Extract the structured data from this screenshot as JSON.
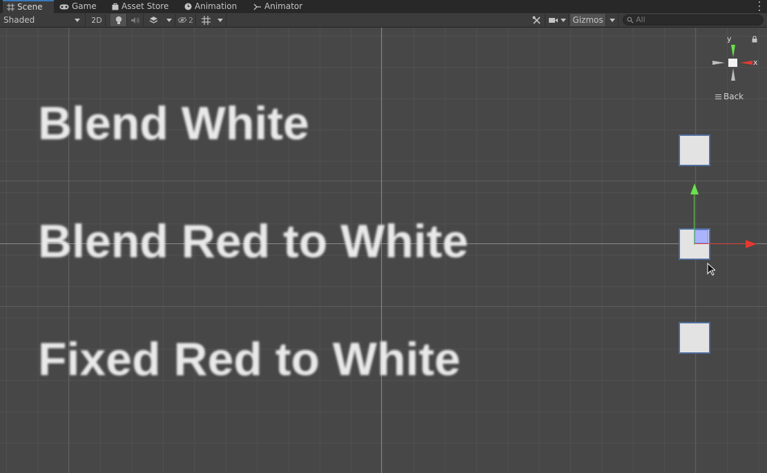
{
  "tabs": [
    {
      "label": "Scene",
      "icon": "grid-icon",
      "active": true
    },
    {
      "label": "Game",
      "icon": "gamepad-icon",
      "active": false
    },
    {
      "label": "Asset Store",
      "icon": "bag-icon",
      "active": false
    },
    {
      "label": "Animation",
      "icon": "clock-icon",
      "active": false
    },
    {
      "label": "Animator",
      "icon": "animator-icon",
      "active": false
    }
  ],
  "toolbar": {
    "shading_mode": "Shaded",
    "mode_2d_label": "2D",
    "hidden_count": "2",
    "gizmos_label": "Gizmos",
    "search_placeholder": "All"
  },
  "scene": {
    "texts": [
      "Blend White",
      "Blend Red to White",
      "Fixed Red to White"
    ]
  },
  "orientation_gizmo": {
    "y_label": "y",
    "x_label": "x",
    "back_label": "Back"
  },
  "colors": {
    "x_axis": "#e23a31",
    "y_axis": "#6ae04e",
    "selection_outline": "#4f6d9c",
    "active_tab_accent": "#3a79bb"
  }
}
